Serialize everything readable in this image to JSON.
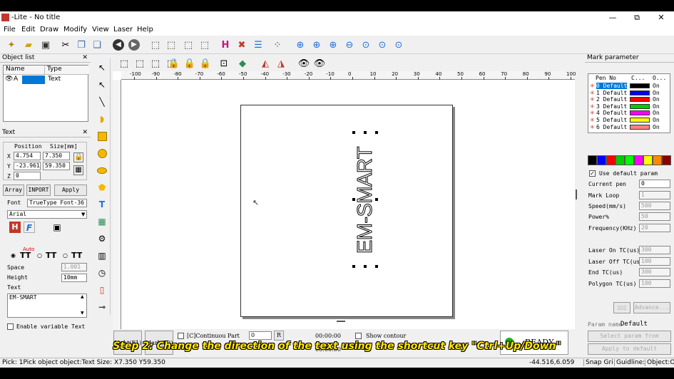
{
  "window": {
    "title": "-Lite  - No title",
    "min": "—",
    "max": "⧉",
    "close": "✕"
  },
  "menu": [
    "File",
    "Edit",
    "Draw",
    "Modify",
    "View",
    "Laser",
    "Help"
  ],
  "object_list": {
    "title": "Object list",
    "col_name": "Name",
    "col_type": "Type",
    "rows": [
      {
        "name": "A",
        "type": "Text"
      }
    ]
  },
  "text_panel": {
    "title": "Text",
    "position_label": "Position",
    "size_label": "Size[mm]",
    "x_label": "X",
    "y_label": "Y",
    "z_label": "Z",
    "x_pos": "4.754",
    "x_size": "7.350",
    "y_pos": "-23.961",
    "y_size": "59.350",
    "z_pos": "0",
    "array_btn": "Array",
    "inport_btn": "INPORT",
    "apply_btn": "Apply",
    "font_label": "Font",
    "font_type": "TrueType Font-36",
    "font_name": "Arial",
    "auto_label": "Auto",
    "space_label": "Space",
    "space_value": "1.001",
    "height_label": "Height",
    "height_value": "10mm",
    "text_label": "Text",
    "text_value": "EM-SMART",
    "enable_variable": "Enable variable Text"
  },
  "canvas": {
    "ruler_ticks": [
      "-100",
      "-90",
      "-80",
      "-70",
      "-60",
      "-50",
      "-40",
      "-30",
      "-20",
      "-10",
      "0",
      "10",
      "20",
      "30",
      "40",
      "50",
      "60",
      "70",
      "80",
      "90",
      "100"
    ],
    "object_text": "EM-SMART"
  },
  "bottom_bar": {
    "light_btn": "Light(F1)",
    "mark_btn": "Mark(F2)",
    "continuous_label": "[C]Continuou Part",
    "count_value": "0",
    "r_btn": "R",
    "time1": "00:00:00",
    "time2": "00:00:00",
    "show_contour": "Show contour",
    "ready_text": "READY"
  },
  "mark_param": {
    "title": "Mark parameter",
    "col_pen": "Pen No",
    "col_c": "C...",
    "col_on": "O...",
    "pens": [
      {
        "name": "0 Default",
        "color": "#000000",
        "on": "On"
      },
      {
        "name": "1 Default",
        "color": "#0000ff",
        "on": "On"
      },
      {
        "name": "2 Default",
        "color": "#ff0000",
        "on": "On"
      },
      {
        "name": "3 Default",
        "color": "#00cc00",
        "on": "On"
      },
      {
        "name": "4 Default",
        "color": "#ff00ff",
        "on": "On"
      },
      {
        "name": "5 Default",
        "color": "#ffff00",
        "on": "On"
      },
      {
        "name": "6 Default",
        "color": "#ff8080",
        "on": "On"
      }
    ],
    "palette": [
      "#000000",
      "#0000ff",
      "#ff0000",
      "#00cc00",
      "#00ff00",
      "#ff00ff",
      "#ffff00",
      "#ff8800",
      "#8b0000"
    ],
    "use_default": "Use default param",
    "current_pen_label": "Current pen",
    "current_pen_value": "0",
    "mark_loop_label": "Mark Loop",
    "mark_loop_value": "1",
    "speed_label": "Speed(mm/s)",
    "speed_value": "500",
    "power_label": "Power%",
    "power_value": "50",
    "freq_label": "Frequency(KHz)",
    "freq_value": "20",
    "laser_on_label": "Laser On TC(us)",
    "laser_on_value": "300",
    "laser_off_label": "Laser Off TC(us)",
    "laser_off_value": "100",
    "end_tc_label": "End TC(us)",
    "end_tc_value": "300",
    "polygon_label": "Polygon TC(us)",
    "polygon_value": "100",
    "advance_btn": "Advance...",
    "param_name_label": "Param name",
    "param_name_value": "Default",
    "select_param_btn": "Select param from library",
    "apply_default_btn": "Apply to default"
  },
  "statusbar": {
    "left": "Pick: 1Pick object object:Text Size: X7.350 Y59.350",
    "coords": "-44.516,6.059",
    "snap": "Snap Gri",
    "guideline": "Guidline:",
    "object": "Object:O"
  },
  "subtitle": "Step 2: Change the direction of the text using the shortcut key \"Ctrl+Up/Down\""
}
